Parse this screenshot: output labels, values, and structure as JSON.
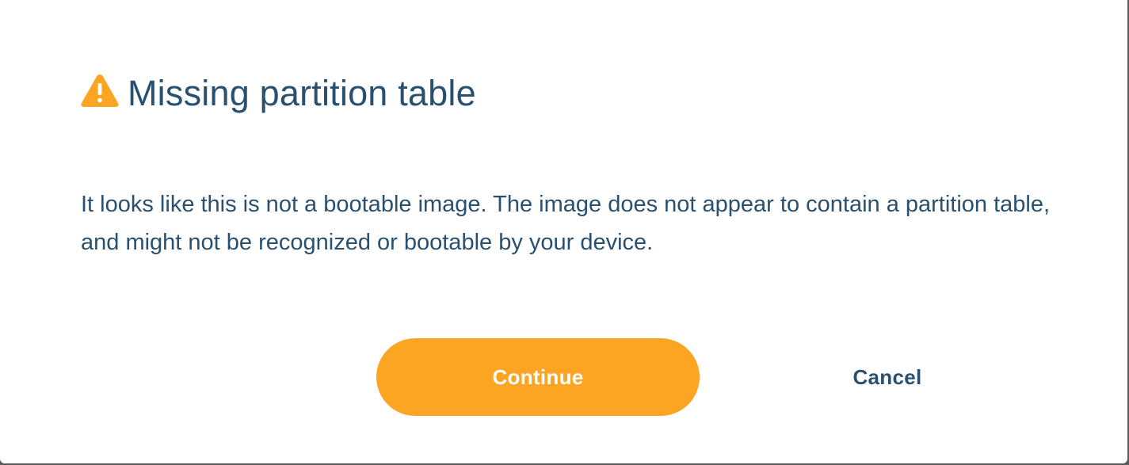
{
  "dialog": {
    "title": "Missing partition table",
    "icon": "warning-triangle-icon",
    "message": "It looks like this is not a bootable image. The image does not appear to contain a partition table, and might not be recognized or bootable by your device.",
    "buttons": {
      "continue_label": "Continue",
      "cancel_label": "Cancel"
    }
  },
  "colors": {
    "accent": "#fba523",
    "text": "#2a506f",
    "background": "#ffffff"
  }
}
